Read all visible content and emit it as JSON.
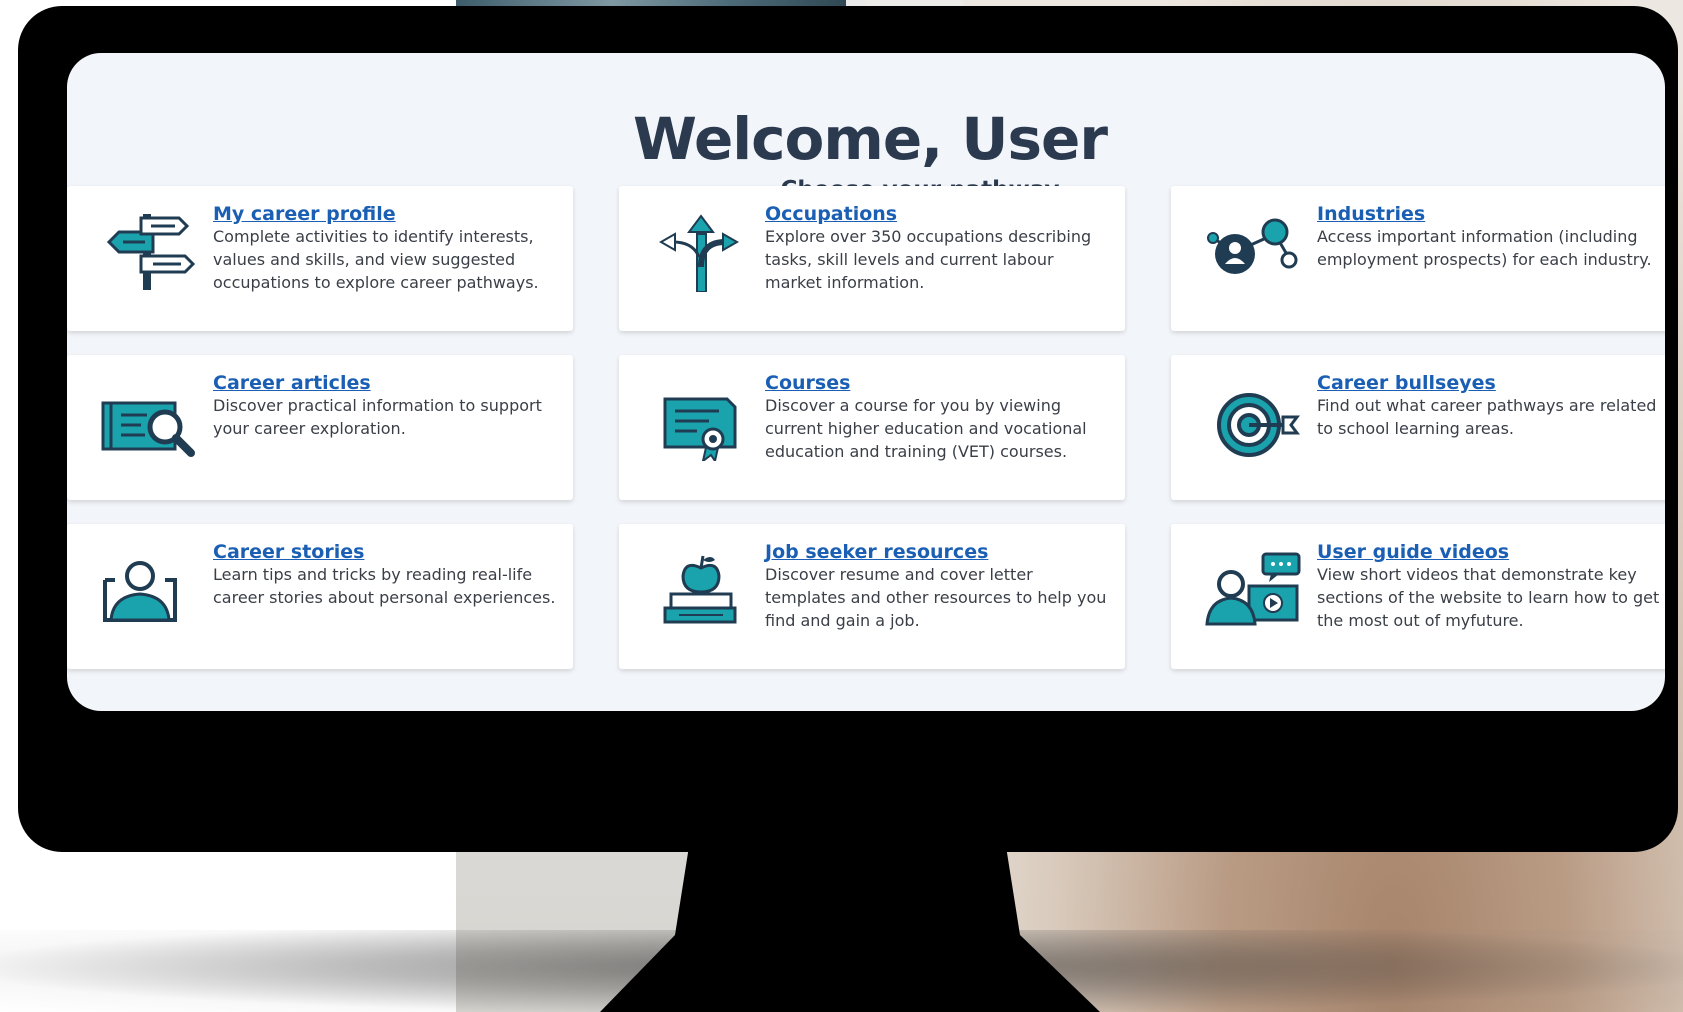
{
  "screen": {
    "title": "Welcome, User",
    "subtitle": "Choose your pathway"
  },
  "colors": {
    "accent": "#1a5fb4",
    "icon_teal": "#1aa3ad",
    "icon_dark": "#1f3c52",
    "title": "#2b3a4f"
  },
  "cards": [
    {
      "title": "My career profile",
      "desc": "Complete activities to identify interests, values and skills, and view suggested occupations to explore career pathways.",
      "icon": "signpost-icon"
    },
    {
      "title": "Occupations",
      "desc": "Explore over 350 occupations describing tasks, skill levels and current labour market information.",
      "icon": "branching-arrows-icon"
    },
    {
      "title": "Industries",
      "desc": "Access important information (including employment prospects) for each industry.",
      "icon": "network-person-icon"
    },
    {
      "title": "Career articles",
      "desc": "Discover practical information to support your career exploration.",
      "icon": "newspaper-magnifier-icon"
    },
    {
      "title": "Courses",
      "desc": "Discover a course for you by viewing current higher education and vocational education and training (VET) courses.",
      "icon": "certificate-icon"
    },
    {
      "title": "Career bullseyes",
      "desc": "Find out what career pathways are related to school learning areas.",
      "icon": "bullseye-icon"
    },
    {
      "title": "Career stories",
      "desc": "Learn tips and tricks by reading real-life career stories about personal experiences.",
      "icon": "person-frame-icon"
    },
    {
      "title": "Job seeker resources",
      "desc": "Discover resume and cover letter templates and other resources to help you find and gain a job.",
      "icon": "apple-books-icon"
    },
    {
      "title": "User guide videos",
      "desc": "View short videos that demonstrate key sections of the website to learn how to get the most out of myfuture.",
      "icon": "video-guide-icon"
    }
  ]
}
